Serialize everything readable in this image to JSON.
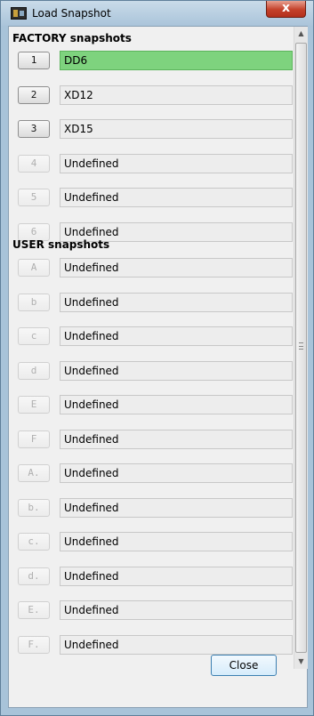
{
  "window": {
    "title": "Load Snapshot",
    "close_glyph": "x"
  },
  "factory": {
    "header": "FACTORY snapshots",
    "items": [
      {
        "slot": "1",
        "name": "DD6",
        "enabled": true,
        "active": true
      },
      {
        "slot": "2",
        "name": "XD12",
        "enabled": true,
        "active": false
      },
      {
        "slot": "3",
        "name": "XD15",
        "enabled": true,
        "active": false
      },
      {
        "slot": "4",
        "name": "Undefined",
        "enabled": false,
        "active": false
      },
      {
        "slot": "5",
        "name": "Undefined",
        "enabled": false,
        "active": false
      },
      {
        "slot": "6",
        "name": "Undefined",
        "enabled": false,
        "active": false
      }
    ]
  },
  "user": {
    "header": "USER snapshots",
    "items": [
      {
        "slot": "A",
        "name": "Undefined",
        "enabled": false
      },
      {
        "slot": "b",
        "name": "Undefined",
        "enabled": false
      },
      {
        "slot": "c",
        "name": "Undefined",
        "enabled": false
      },
      {
        "slot": "d",
        "name": "Undefined",
        "enabled": false
      },
      {
        "slot": "E",
        "name": "Undefined",
        "enabled": false
      },
      {
        "slot": "F",
        "name": "Undefined",
        "enabled": false
      },
      {
        "slot": "A.",
        "name": "Undefined",
        "enabled": false
      },
      {
        "slot": "b.",
        "name": "Undefined",
        "enabled": false
      },
      {
        "slot": "c.",
        "name": "Undefined",
        "enabled": false
      },
      {
        "slot": "d.",
        "name": "Undefined",
        "enabled": false
      },
      {
        "slot": "E.",
        "name": "Undefined",
        "enabled": false
      },
      {
        "slot": "F.",
        "name": "Undefined",
        "enabled": false
      }
    ]
  },
  "footer": {
    "close_label": "Close"
  },
  "colors": {
    "active_slot": "#7ed37e",
    "titlebar": "#aac4da",
    "close_button_border": "#3c7fb1"
  }
}
